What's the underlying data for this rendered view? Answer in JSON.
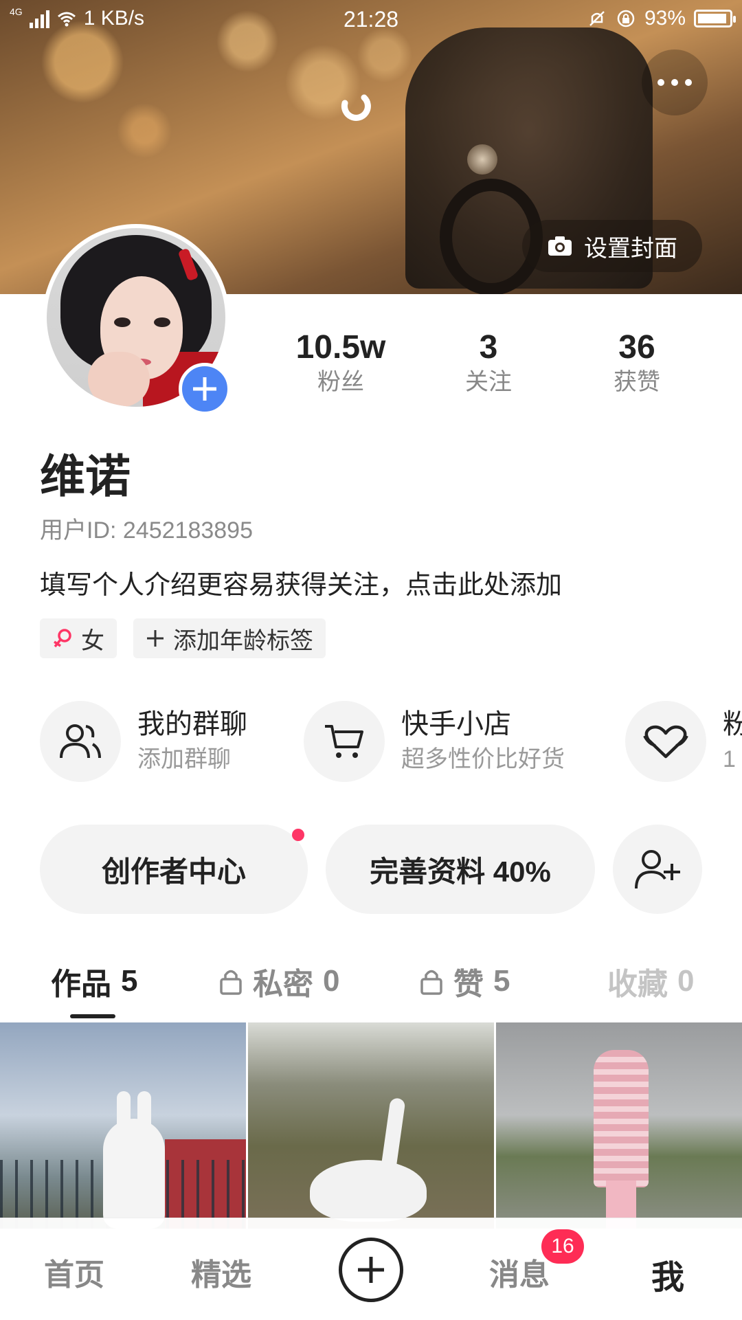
{
  "status_bar": {
    "network": "4G",
    "speed": "1 KB/s",
    "time": "21:28",
    "battery": "93%",
    "battery_level": 0.93
  },
  "cover": {
    "set_cover_label": "设置封面"
  },
  "stats": [
    {
      "value": "10.5w",
      "label": "粉丝"
    },
    {
      "value": "3",
      "label": "关注"
    },
    {
      "value": "36",
      "label": "获赞"
    }
  ],
  "profile": {
    "name": "维诺",
    "user_id": "用户ID: 2452183895",
    "bio_prompt": "填写个人介绍更容易获得关注，点击此处添加",
    "tags": [
      {
        "label": "女",
        "icon": "female-icon"
      },
      {
        "label": "添加年龄标签",
        "icon": "plus-icon"
      }
    ]
  },
  "shortcuts": [
    {
      "title": "我的群聊",
      "subtitle": "添加群聊",
      "icon": "group-icon"
    },
    {
      "title": "快手小店",
      "subtitle": "超多性价比好货",
      "icon": "cart-icon"
    },
    {
      "title": "粉",
      "subtitle": "1",
      "icon": "heart-hands-icon"
    }
  ],
  "actions": {
    "creator_center": "创作者中心",
    "complete_profile": "完善资料 40%",
    "add_friend_icon": "add-user-icon"
  },
  "tabs": [
    {
      "label": "作品",
      "count": "5",
      "locked": false
    },
    {
      "label": "私密",
      "count": "0",
      "locked": true
    },
    {
      "label": "赞",
      "count": "5",
      "locked": true
    },
    {
      "label": "收藏",
      "count": "0",
      "locked": false
    }
  ],
  "bottom_nav": {
    "items": [
      "首页",
      "精选",
      "消息",
      "我"
    ],
    "message_badge": "16"
  },
  "colors": {
    "accent_blue": "#4d85f5",
    "badge_red": "#fe2c55",
    "dot_red": "#fe3666"
  }
}
